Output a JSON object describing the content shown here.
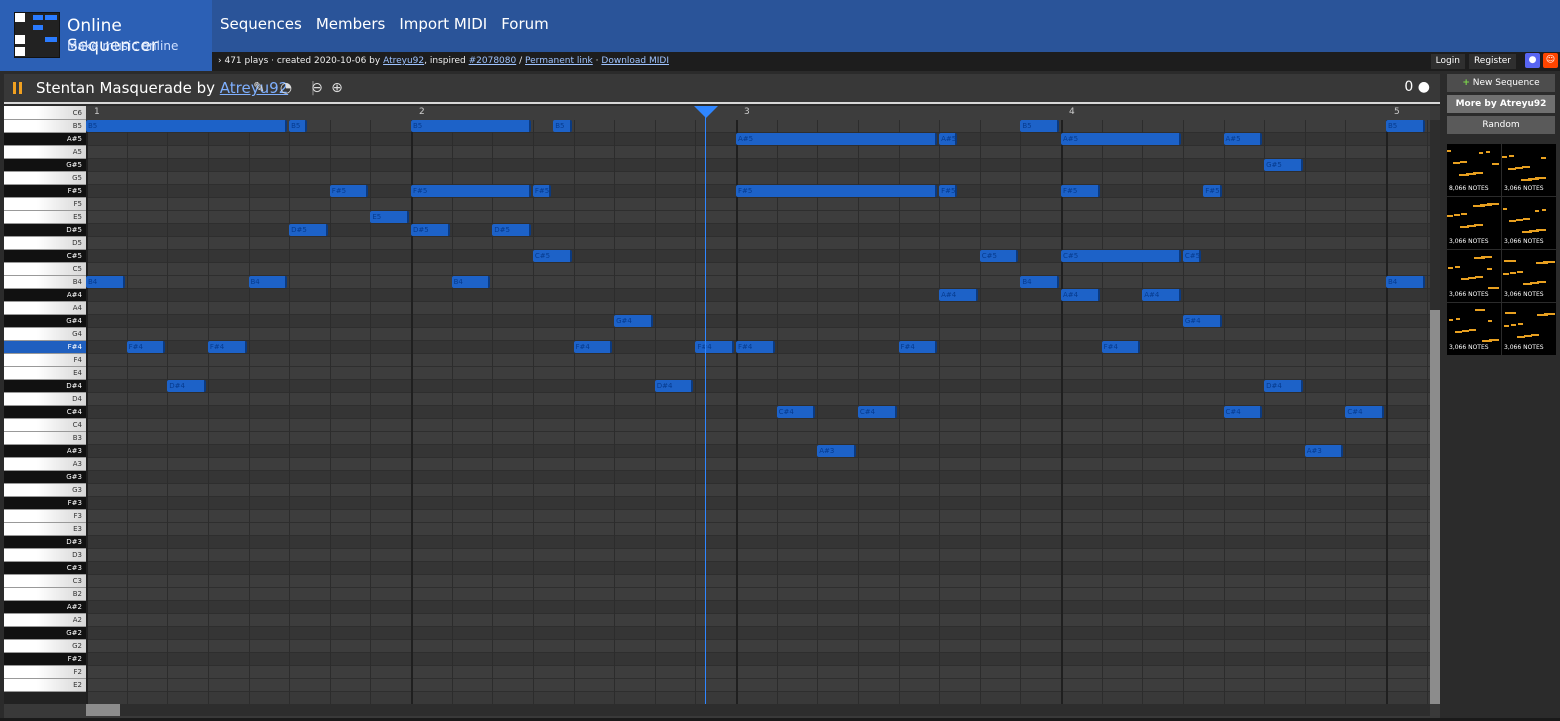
{
  "header": {
    "logo_title": "Online Sequencer",
    "logo_subtitle": "Make music online",
    "nav": [
      "Sequences",
      "Members",
      "Import MIDI",
      "Forum"
    ],
    "accent": "#2a5499"
  },
  "infobar": {
    "arrow": "›",
    "plays": "471 plays · created 2020-10-06 by",
    "author": "Atreyu92",
    "inspired": ", inspired",
    "inspired_link": "#2078080",
    "sep": "/",
    "permalink": "Permanent link",
    "dot": "·",
    "download": "Download MIDI",
    "login": "Login",
    "register": "Register"
  },
  "sequence": {
    "title_prefix": "Stentan Masquerade by",
    "author": "Atreyu92",
    "comment_count": "0"
  },
  "sidebar": {
    "new_sequence": "New Sequence",
    "more_by": "More by Atreyu92",
    "random": "Random",
    "thumbs": [
      "8,066 NOTES",
      "3,066 NOTES",
      "3,066 NOTES",
      "3,066 NOTES",
      "3,066 NOTES",
      "3,066 NOTES",
      "3,066 NOTES",
      "3,066 NOTES"
    ]
  },
  "ruler": {
    "bars": [
      "1",
      "2",
      "3",
      "4",
      "5"
    ]
  },
  "keys": {
    "top_label": "C6",
    "rows": [
      "B5",
      "A#5",
      "A5",
      "G#5",
      "G5",
      "F#5",
      "F5",
      "E5",
      "D#5",
      "D5",
      "C#5",
      "C5",
      "B4",
      "A#4",
      "A4",
      "G#4",
      "G4",
      "F#4",
      "F4",
      "E4",
      "D#4",
      "D4",
      "C#4",
      "C4",
      "B3",
      "A#3",
      "A3",
      "G#3",
      "G3",
      "F#3",
      "F3",
      "E3",
      "D#3",
      "D3",
      "C#3",
      "C3",
      "B2",
      "A#2",
      "A2",
      "G#2",
      "G2",
      "F#2",
      "F2",
      "E2"
    ],
    "highlighted": "F#4"
  },
  "notes": [
    {
      "n": "B5",
      "start": 0,
      "len": 2.5
    },
    {
      "n": "B5",
      "start": 2.5,
      "len": 0.25
    },
    {
      "n": "B5",
      "start": 4,
      "len": 1.5
    },
    {
      "n": "B5",
      "start": 5.75,
      "len": 0.25
    },
    {
      "n": "B5",
      "start": 11.5,
      "len": 0.5
    },
    {
      "n": "B5",
      "start": 16,
      "len": 0.5
    },
    {
      "n": "A#5",
      "start": 8,
      "len": 2.5
    },
    {
      "n": "A#5",
      "start": 10.5,
      "len": 0.25
    },
    {
      "n": "A#5",
      "start": 12,
      "len": 1.5
    },
    {
      "n": "A#5",
      "start": 14,
      "len": 0.5
    },
    {
      "n": "G#5",
      "start": 14.5,
      "len": 0.5
    },
    {
      "n": "F#5",
      "start": 3,
      "len": 0.5
    },
    {
      "n": "F#5",
      "start": 4,
      "len": 1.5
    },
    {
      "n": "F#5",
      "start": 5.5,
      "len": 0.25
    },
    {
      "n": "F#5",
      "start": 8,
      "len": 2.5
    },
    {
      "n": "F#5",
      "start": 10.5,
      "len": 0.25
    },
    {
      "n": "F#5",
      "start": 12,
      "len": 0.5
    },
    {
      "n": "F#5",
      "start": 13.75,
      "len": 0.25
    },
    {
      "n": "E5",
      "start": 3.5,
      "len": 0.5
    },
    {
      "n": "D#5",
      "start": 2.5,
      "len": 0.5
    },
    {
      "n": "D#5",
      "start": 4,
      "len": 0.5
    },
    {
      "n": "D#5",
      "start": 5,
      "len": 0.5
    },
    {
      "n": "C#5",
      "start": 5.5,
      "len": 0.5
    },
    {
      "n": "C#5",
      "start": 11,
      "len": 0.5
    },
    {
      "n": "C#5",
      "start": 12,
      "len": 1.5
    },
    {
      "n": "C#5",
      "start": 13.5,
      "len": 0.25
    },
    {
      "n": "B4",
      "start": 0,
      "len": 0.5
    },
    {
      "n": "B4",
      "start": 2,
      "len": 0.5
    },
    {
      "n": "B4",
      "start": 4.5,
      "len": 0.5
    },
    {
      "n": "B4",
      "start": 11.5,
      "len": 0.5
    },
    {
      "n": "B4",
      "start": 16,
      "len": 0.5
    },
    {
      "n": "A#4",
      "start": 10.5,
      "len": 0.5
    },
    {
      "n": "A#4",
      "start": 12,
      "len": 0.5
    },
    {
      "n": "A#4",
      "start": 13,
      "len": 0.5
    },
    {
      "n": "G#4",
      "start": 6.5,
      "len": 0.5
    },
    {
      "n": "G#4",
      "start": 13.5,
      "len": 0.5
    },
    {
      "n": "F#4",
      "start": 0.5,
      "len": 0.5
    },
    {
      "n": "F#4",
      "start": 1.5,
      "len": 0.5
    },
    {
      "n": "F#4",
      "start": 6,
      "len": 0.5
    },
    {
      "n": "F#4",
      "start": 7.5,
      "len": 0.5
    },
    {
      "n": "F#4",
      "start": 8,
      "len": 0.5
    },
    {
      "n": "F#4",
      "start": 10,
      "len": 0.5
    },
    {
      "n": "F#4",
      "start": 12.5,
      "len": 0.5
    },
    {
      "n": "D#4",
      "start": 1,
      "len": 0.5
    },
    {
      "n": "D#4",
      "start": 7,
      "len": 0.5
    },
    {
      "n": "D#4",
      "start": 14.5,
      "len": 0.5
    },
    {
      "n": "C#4",
      "start": 8.5,
      "len": 0.5
    },
    {
      "n": "C#4",
      "start": 9.5,
      "len": 0.5
    },
    {
      "n": "C#4",
      "start": 14,
      "len": 0.5
    },
    {
      "n": "C#4",
      "start": 15.5,
      "len": 0.5
    },
    {
      "n": "A#3",
      "start": 9,
      "len": 0.5
    },
    {
      "n": "A#3",
      "start": 15,
      "len": 0.5
    }
  ]
}
